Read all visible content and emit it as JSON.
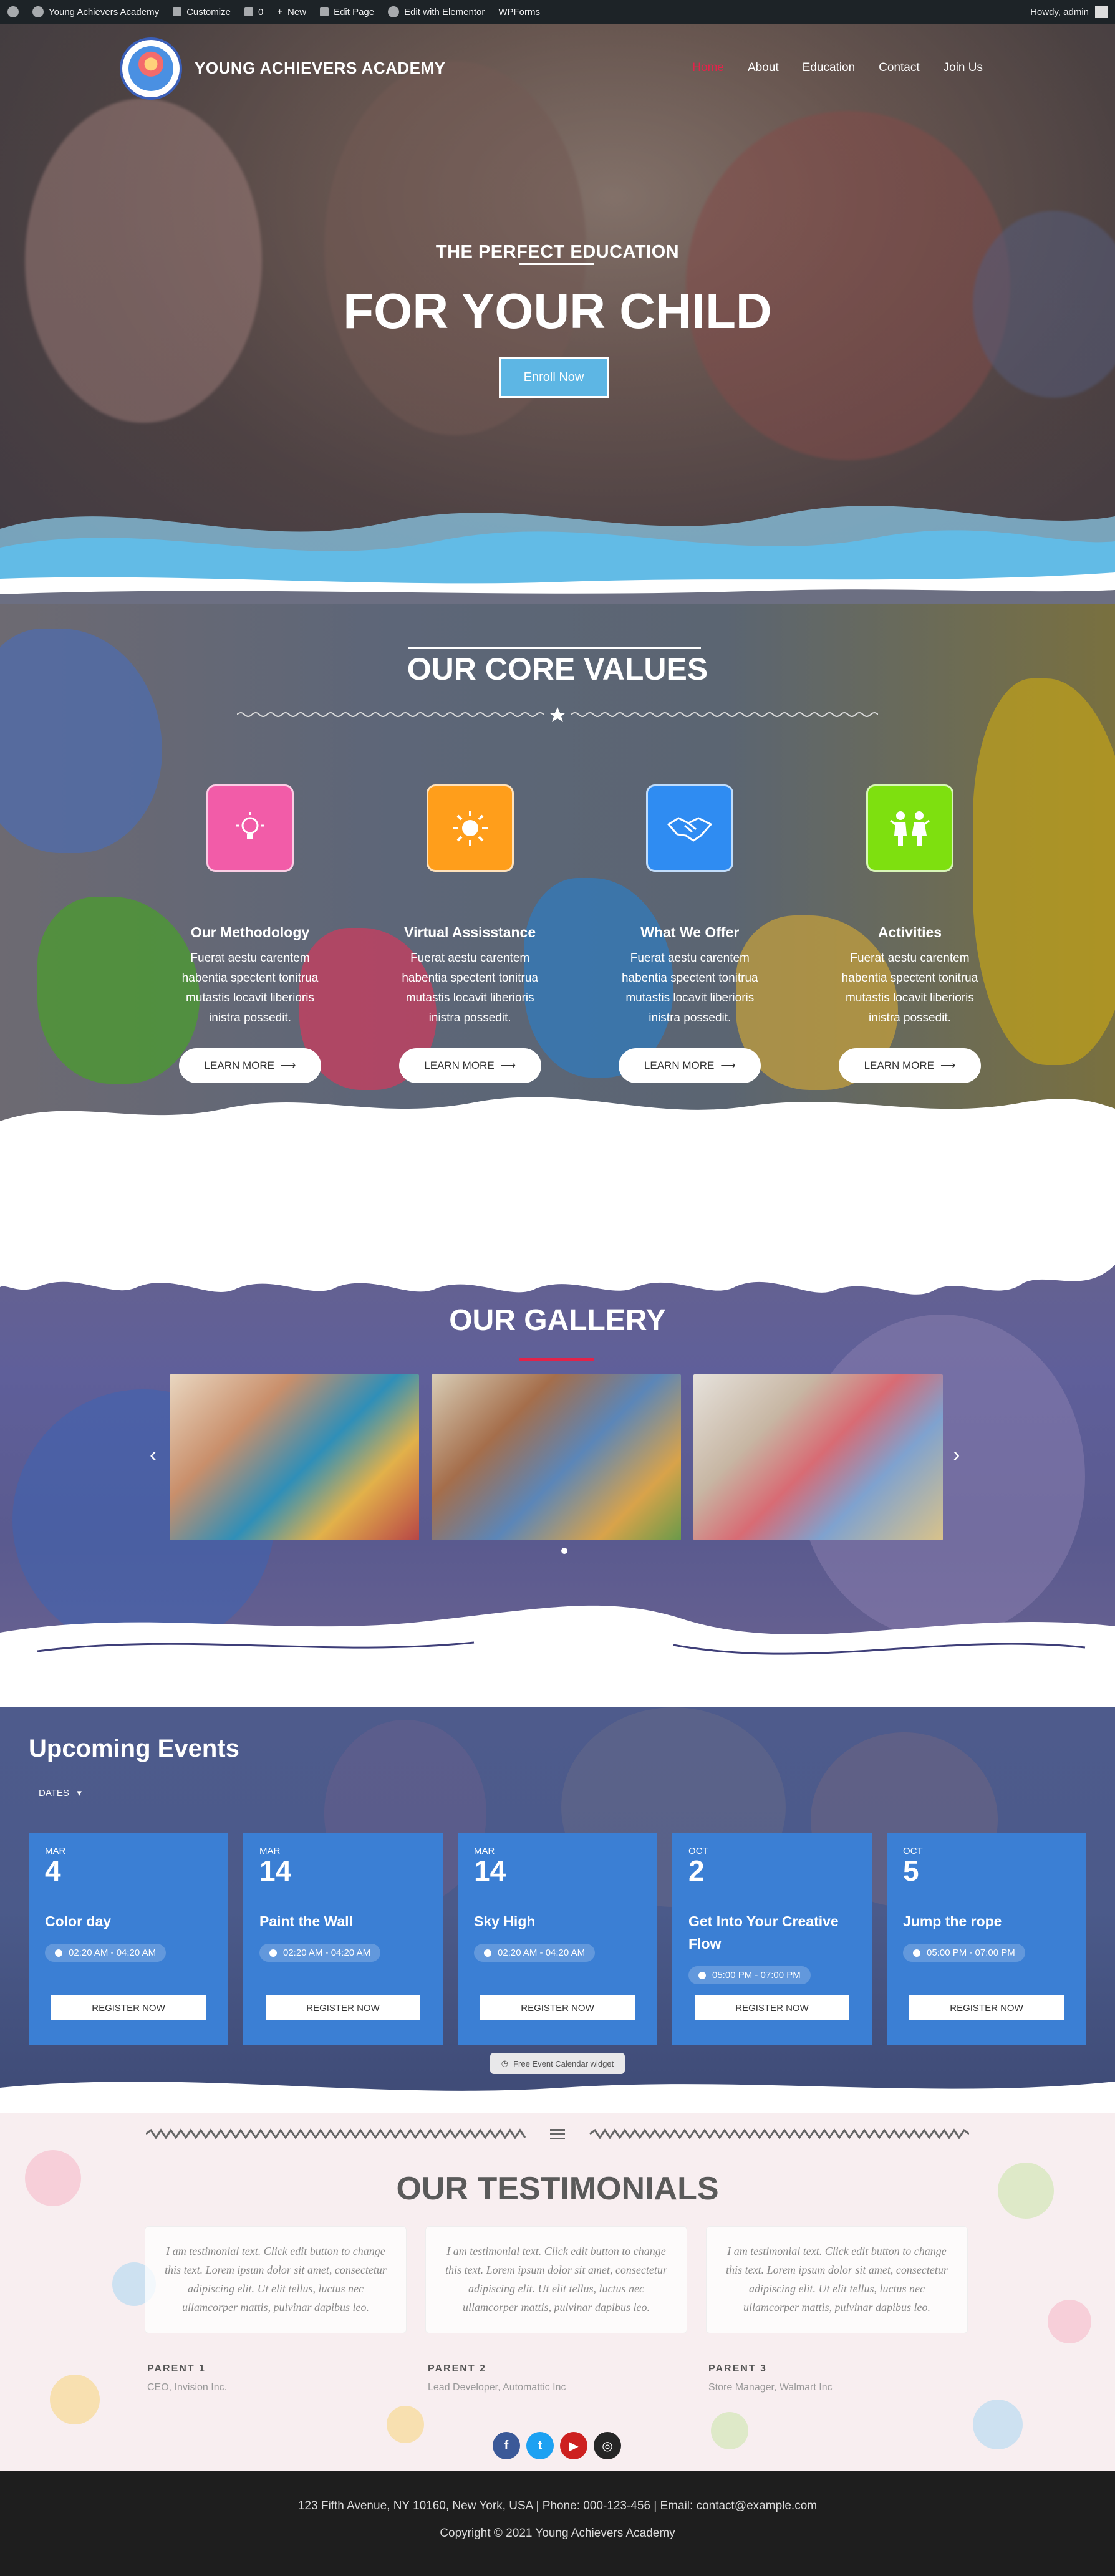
{
  "admin_bar": {
    "site_name": "Young Achievers Academy",
    "customize": "Customize",
    "comments": "0",
    "new": "New",
    "edit_page": "Edit Page",
    "edit_elementor": "Edit with Elementor",
    "wpforms": "WPForms",
    "howdy": "Howdy, admin"
  },
  "header": {
    "brand": "YOUNG ACHIEVERS ACADEMY",
    "menu": [
      "Home",
      "About",
      "Education",
      "Contact",
      "Join Us"
    ]
  },
  "hero": {
    "subtitle": "THE PERFECT EDUCATION",
    "title": "FOR YOUR CHILD",
    "cta": "Enroll Now"
  },
  "core_values": {
    "title": "OUR CORE VALUES",
    "items": [
      {
        "title": "Our Methodology",
        "text": "Fuerat aestu carentem habentia spectent tonitrua mutastis locavit liberioris inistra possedit.",
        "button": "LEARN MORE",
        "icon": "lightbulb-icon",
        "color": "#f25ca8"
      },
      {
        "title": "Virtual Assisstance",
        "text": "Fuerat aestu carentem habentia spectent tonitrua mutastis locavit liberioris inistra possedit.",
        "button": "LEARN MORE",
        "icon": "sun-icon",
        "color": "#ff9e1b"
      },
      {
        "title": "What We Offer",
        "text": "Fuerat aestu carentem habentia spectent tonitrua mutastis locavit liberioris inistra possedit.",
        "button": "LEARN MORE",
        "icon": "handshake-icon",
        "color": "#2f8cf2"
      },
      {
        "title": "Activities",
        "text": "Fuerat aestu carentem habentia spectent tonitrua mutastis locavit liberioris inistra possedit.",
        "button": "LEARN MORE",
        "icon": "children-icon",
        "color": "#7ee00f"
      }
    ]
  },
  "gallery": {
    "title": "OUR GALLERY"
  },
  "events": {
    "title": "Upcoming Events",
    "filter": "DATES",
    "items": [
      {
        "month": "MAR",
        "day": "4",
        "title": "Color day",
        "time": "02:20 AM - 04:20 AM",
        "button": "REGISTER NOW"
      },
      {
        "month": "MAR",
        "day": "14",
        "title": "Paint the Wall",
        "time": "02:20 AM - 04:20 AM",
        "button": "REGISTER NOW"
      },
      {
        "month": "MAR",
        "day": "14",
        "title": "Sky High",
        "time": "02:20 AM - 04:20 AM",
        "button": "REGISTER NOW"
      },
      {
        "month": "OCT",
        "day": "2",
        "title": "Get Into Your Creative Flow",
        "time": "05:00 PM - 07:00 PM",
        "button": "REGISTER NOW"
      },
      {
        "month": "OCT",
        "day": "5",
        "title": "Jump the rope",
        "time": "05:00 PM - 07:00 PM",
        "button": "REGISTER NOW"
      }
    ],
    "widget_label": "Free Event Calendar widget"
  },
  "testimonials": {
    "title": "OUR TESTIMONIALS",
    "items": [
      {
        "text": "I am testimonial text. Click edit button to change this text. Lorem ipsum dolor sit amet, consectetur adipiscing elit. Ut elit tellus, luctus nec ullamcorper mattis, pulvinar dapibus leo.",
        "name": "PARENT 1",
        "role": "CEO, Invision Inc."
      },
      {
        "text": "I am testimonial text. Click edit button to change this text. Lorem ipsum dolor sit amet, consectetur adipiscing elit. Ut elit tellus, luctus nec ullamcorper mattis, pulvinar dapibus leo.",
        "name": "PARENT 2",
        "role": "Lead Developer, Automattic Inc"
      },
      {
        "text": "I am testimonial text. Click edit button to change this text. Lorem ipsum dolor sit amet, consectetur adipiscing elit. Ut elit tellus, luctus nec ullamcorper mattis, pulvinar dapibus leo.",
        "name": "PARENT 3",
        "role": "Store Manager, Walmart Inc"
      }
    ],
    "socials": [
      {
        "name": "facebook-icon",
        "glyph": "f",
        "color": "#3b5998"
      },
      {
        "name": "twitter-icon",
        "glyph": "t",
        "color": "#1da1f2"
      },
      {
        "name": "youtube-icon",
        "glyph": "▶",
        "color": "#cd201f"
      },
      {
        "name": "instagram-icon",
        "glyph": "◎",
        "color": "#262626"
      }
    ]
  },
  "footer": {
    "contact": "123 Fifth Avenue, NY 10160, New York, USA | Phone: 000-123-456 | Email: contact@example.com",
    "copyright": "Copyright © 2021 Young Achievers Academy"
  }
}
